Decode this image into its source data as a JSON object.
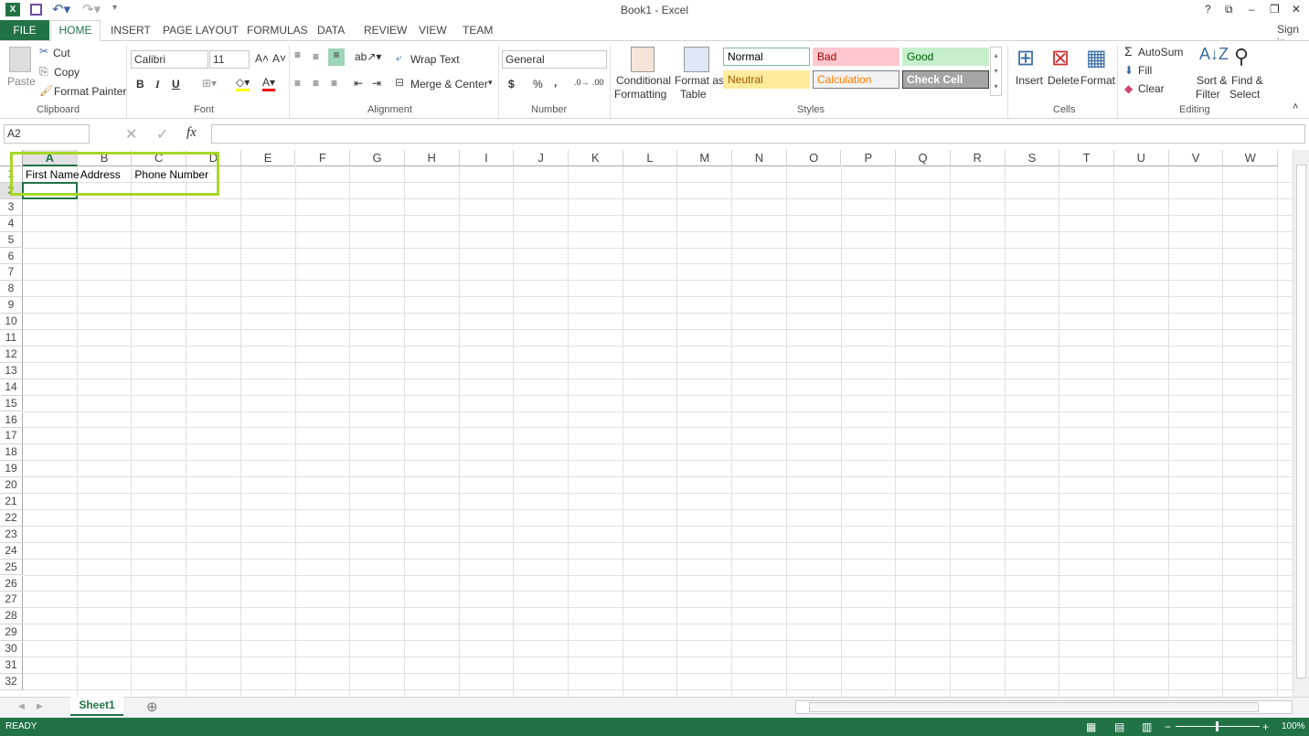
{
  "title": "Book1 - Excel",
  "title_controls": [
    "?",
    "⧉",
    "–",
    "❐",
    "✕"
  ],
  "tabs": {
    "file": "FILE",
    "home": "HOME",
    "others": [
      "INSERT",
      "PAGE LAYOUT",
      "FORMULAS",
      "DATA",
      "REVIEW",
      "VIEW",
      "TEAM"
    ],
    "sign_in": "Sign in"
  },
  "ribbon": {
    "clipboard": {
      "paste": "Paste",
      "cut": "Cut",
      "copy": "Copy",
      "format_painter": "Format Painter",
      "label": "Clipboard"
    },
    "font": {
      "name": "Calibri",
      "size": "11",
      "bold": "B",
      "italic": "I",
      "underline": "U",
      "label": "Font"
    },
    "alignment": {
      "wrap": "Wrap Text",
      "merge": "Merge & Center",
      "label": "Alignment"
    },
    "number": {
      "format": "General",
      "currency": "$",
      "percent": "%",
      "comma": ",",
      "label": "Number"
    },
    "styles": {
      "cond1": "Conditional",
      "cond2": "Formatting",
      "table1": "Format as",
      "table2": "Table",
      "items": [
        {
          "name": "Normal",
          "bg": "#ffffff",
          "fg": "#000000",
          "border": "#7fb99f"
        },
        {
          "name": "Bad",
          "bg": "#ffc7ce",
          "fg": "#9c0006",
          "border": "#ffc7ce"
        },
        {
          "name": "Good",
          "bg": "#c6efce",
          "fg": "#006100",
          "border": "#c6efce"
        },
        {
          "name": "Neutral",
          "bg": "#ffeb9c",
          "fg": "#9c5700",
          "border": "#ffeb9c"
        },
        {
          "name": "Calculation",
          "bg": "#f2f2f2",
          "fg": "#fa7d00",
          "border": "#7f7f7f"
        },
        {
          "name": "Check Cell",
          "bg": "#a5a5a5",
          "fg": "#ffffff",
          "border": "#3f3f3f"
        }
      ],
      "label": "Styles"
    },
    "cells": {
      "insert": "Insert",
      "delete": "Delete",
      "format": "Format",
      "label": "Cells"
    },
    "editing": {
      "autosum": "AutoSum",
      "fill": "Fill",
      "clear": "Clear",
      "sort1": "Sort &",
      "sort2": "Filter",
      "find1": "Find &",
      "find2": "Select",
      "label": "Editing"
    }
  },
  "formula_bar": {
    "name_box": "A2",
    "fx": "fx",
    "value": ""
  },
  "columns": [
    "A",
    "B",
    "C",
    "D",
    "E",
    "F",
    "G",
    "H",
    "I",
    "J",
    "K",
    "L",
    "M",
    "N",
    "O",
    "P",
    "Q",
    "R",
    "S",
    "T",
    "U",
    "V",
    "W"
  ],
  "rows": [
    "1",
    "2",
    "3",
    "4",
    "5",
    "6",
    "7",
    "8",
    "9",
    "10",
    "11",
    "12",
    "13",
    "14",
    "15",
    "16",
    "17",
    "18",
    "19",
    "20",
    "21",
    "22",
    "23",
    "24",
    "25",
    "26",
    "27",
    "28",
    "29",
    "30",
    "31",
    "32"
  ],
  "cells": {
    "A1": "First Name",
    "B1": "Address",
    "C1": "Phone Number"
  },
  "selected_cell": "A2",
  "highlight_color": "#a8d629",
  "sheet_tab": "Sheet1",
  "status": {
    "text": "READY",
    "zoom": "100%"
  },
  "accent": "#217346"
}
